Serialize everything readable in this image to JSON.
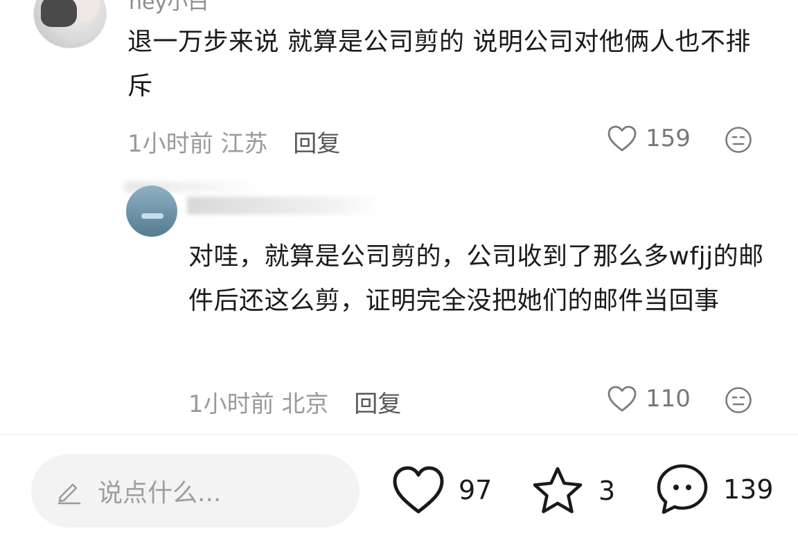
{
  "top_comment": {
    "username": "hey小白",
    "text": "退一万步来说 就算是公司剪的 说明公司对他俩人也不排斥",
    "time": "1小时前",
    "location": "江苏",
    "reply_label": "回复",
    "like_count": "159"
  },
  "reply_comment": {
    "text": "对哇，就算是公司剪的，公司收到了那么多wfjj的邮件后还这么剪，证明完全没把她们的邮件当回事",
    "time": "1小时前",
    "location": "北京",
    "reply_label": "回复",
    "like_count": "110"
  },
  "bottom_bar": {
    "input_placeholder": "说点什么...",
    "like_count": "97",
    "star_count": "3",
    "comment_count": "139"
  },
  "icons": {
    "like": "heart-outline-icon",
    "emotion": "neutral-face-icon",
    "edit": "pencil-icon",
    "star": "star-outline-icon",
    "comment": "chat-bubble-icon"
  },
  "colors": {
    "text_primary": "#1a1a1a",
    "text_meta": "#9a9a9a",
    "input_bg": "#f3f3f3"
  }
}
